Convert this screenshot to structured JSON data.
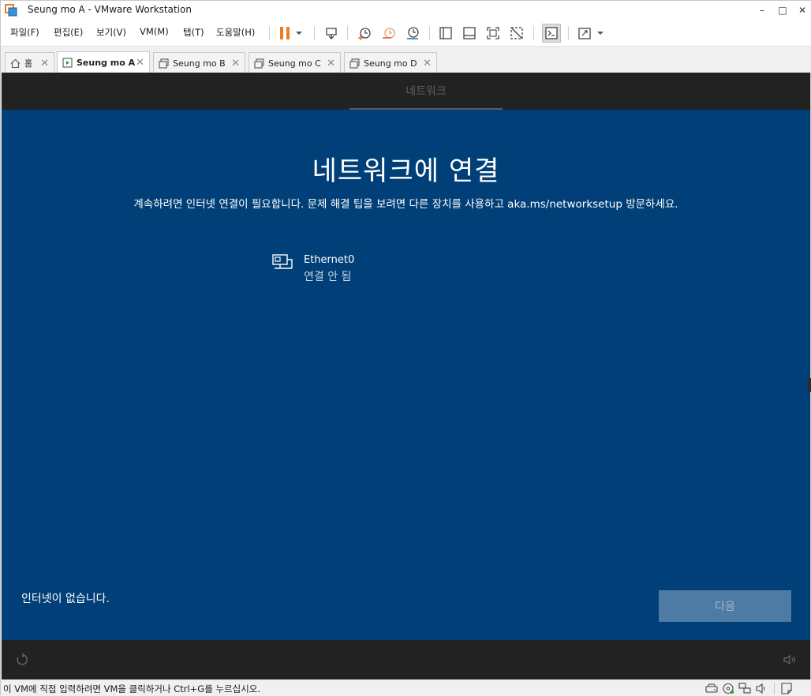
{
  "window": {
    "title": "Seung mo A - VMware Workstation",
    "controls": {
      "minimize": "–",
      "maximize": "□",
      "close": "✕"
    }
  },
  "menu": {
    "items": [
      "파일(F)",
      "편집(E)",
      "보기(V)",
      "VM(M)",
      "탭(T)",
      "도움말(H)"
    ]
  },
  "toolbar": {
    "icons": [
      "pause-icon",
      "dropdown-arrow-icon",
      "send-ctrl-alt-del-icon",
      "snapshot-take-icon",
      "snapshot-revert-icon",
      "snapshot-manager-icon",
      "library-view-icon",
      "thumbnail-view-icon",
      "fullscreen-icon",
      "unity-icon",
      "console-view-icon",
      "stretch-guest-icon",
      "dropdown-arrow-icon"
    ],
    "pause_color": "#f07c1e"
  },
  "tabs": [
    {
      "label": "홈",
      "icon": "home-icon",
      "active": false
    },
    {
      "label": "Seung mo A",
      "icon": "vm-running-icon",
      "active": true
    },
    {
      "label": "Seung mo B",
      "icon": "vm-icon",
      "active": false
    },
    {
      "label": "Seung mo C",
      "icon": "vm-icon",
      "active": false
    },
    {
      "label": "Seung mo D",
      "icon": "vm-icon",
      "active": false
    }
  ],
  "guest": {
    "top_section_label": "네트워크",
    "title": "네트워크에 연결",
    "subtitle": "계속하려면 인터넷 연결이 필요합니다. 문제 해결 팁을 보려면 다른 장치를 사용하고 aka.ms/networksetup 방문하세요.",
    "network": {
      "name": "Ethernet0",
      "status": "연결 안 됨",
      "icon": "ethernet-icon"
    },
    "no_internet_link": "인터넷이 없습니다.",
    "next_button": "다음",
    "bottom_icons": [
      "accessibility-icon",
      "volume-icon"
    ],
    "colors": {
      "background": "#003f77",
      "top_bar": "#222222",
      "button": "#4e7ba3"
    }
  },
  "statusbar": {
    "message": "이 VM에 직접 입력하려면 VM을 클릭하거나 Ctrl+G를 누르십시오.",
    "icons": [
      "hard-disk-icon",
      "cd-dvd-icon",
      "network-adapter-icon",
      "sound-card-icon",
      "message-log-icon"
    ]
  }
}
